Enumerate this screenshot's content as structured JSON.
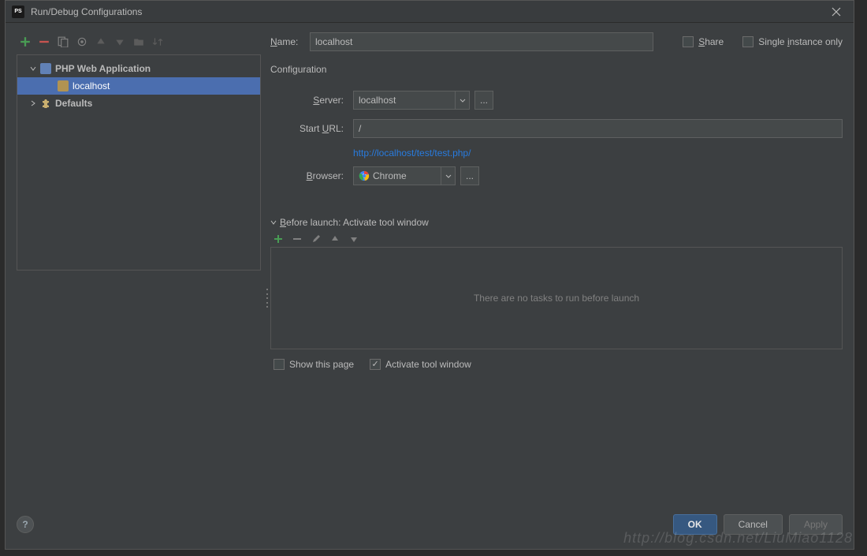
{
  "title": "Run/Debug Configurations",
  "tree": {
    "php_app": "PHP Web Application",
    "localhost": "localhost",
    "defaults": "Defaults"
  },
  "form": {
    "name_label": "Name:",
    "name_value": "localhost",
    "share": "Share",
    "single": "Single instance only",
    "config_title": "Configuration",
    "server_label": "Server:",
    "server_value": "localhost",
    "starturl_label": "Start URL:",
    "starturl_value": "/",
    "resolved_url": "http://localhost/test/test.php/",
    "browser_label": "Browser:",
    "browser_value": "Chrome"
  },
  "before": {
    "title": "Before launch: Activate tool window",
    "empty": "There are no tasks to run before launch",
    "show_page": "Show this page",
    "activate": "Activate tool window"
  },
  "buttons": {
    "ok": "OK",
    "cancel": "Cancel",
    "apply": "Apply"
  },
  "watermark": "http://blog.csdn.net/LiuMiao1128"
}
